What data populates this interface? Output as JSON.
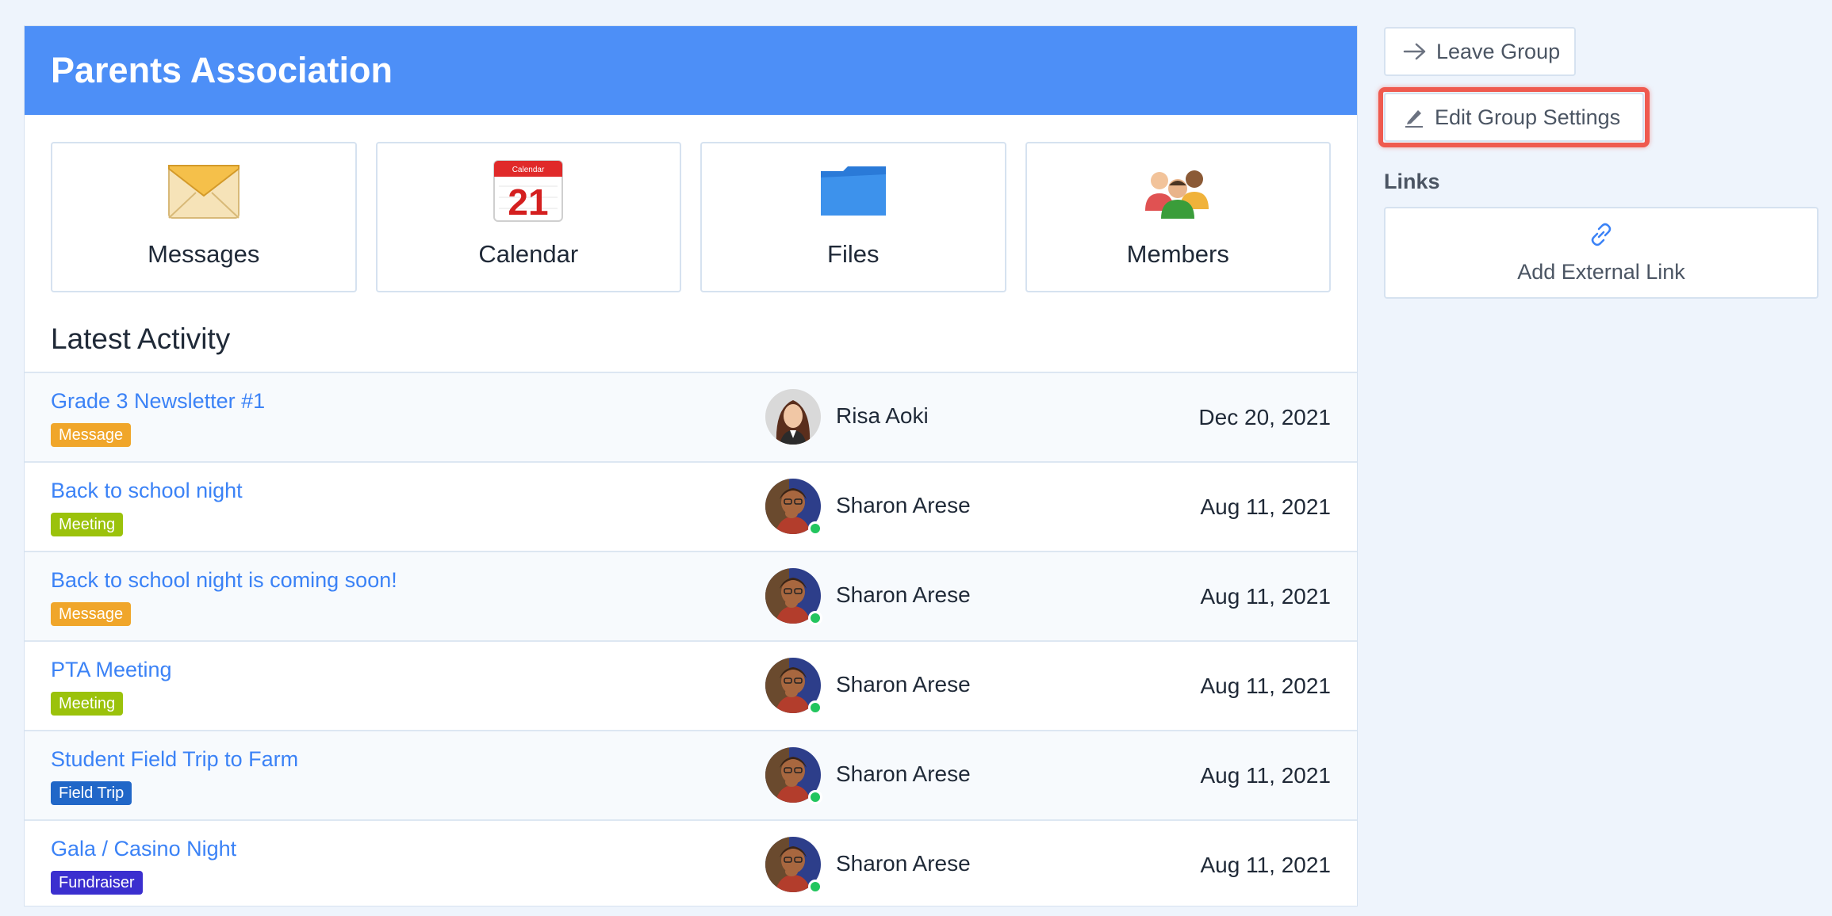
{
  "group": {
    "title": "Parents Association"
  },
  "tiles": [
    {
      "label": "Messages",
      "icon": "envelope-icon"
    },
    {
      "label": "Calendar",
      "icon": "calendar-icon",
      "calendar_top": "Calendar",
      "calendar_day": "21"
    },
    {
      "label": "Files",
      "icon": "folder-icon"
    },
    {
      "label": "Members",
      "icon": "members-icon"
    }
  ],
  "activity": {
    "heading": "Latest Activity",
    "rows": [
      {
        "title": "Grade 3 Newsletter #1",
        "badge": "Message",
        "badge_color": "#f0a62a",
        "author": "Risa Aoki",
        "date": "Dec 20, 2021",
        "online": false
      },
      {
        "title": "Back to school night",
        "badge": "Meeting",
        "badge_color": "#9bc20b",
        "author": "Sharon Arese",
        "date": "Aug 11, 2021",
        "online": true
      },
      {
        "title": "Back to school night is coming soon!",
        "badge": "Message",
        "badge_color": "#f0a62a",
        "author": "Sharon Arese",
        "date": "Aug 11, 2021",
        "online": true
      },
      {
        "title": "PTA Meeting",
        "badge": "Meeting",
        "badge_color": "#9bc20b",
        "author": "Sharon Arese",
        "date": "Aug 11, 2021",
        "online": true
      },
      {
        "title": "Student Field Trip to Farm",
        "badge": "Field Trip",
        "badge_color": "#2167c8",
        "author": "Sharon Arese",
        "date": "Aug 11, 2021",
        "online": true
      },
      {
        "title": "Gala / Casino Night",
        "badge": "Fundraiser",
        "badge_color": "#3b2fcf",
        "author": "Sharon Arese",
        "date": "Aug 11, 2021",
        "online": true
      }
    ]
  },
  "sidebar": {
    "leave_label": "Leave Group",
    "edit_label": "Edit Group Settings",
    "links_heading": "Links",
    "add_link_label": "Add External Link"
  },
  "colors": {
    "header": "#4d8ff7",
    "link": "#3b82f6",
    "highlight": "#ef5a4f",
    "online": "#22c55e"
  }
}
